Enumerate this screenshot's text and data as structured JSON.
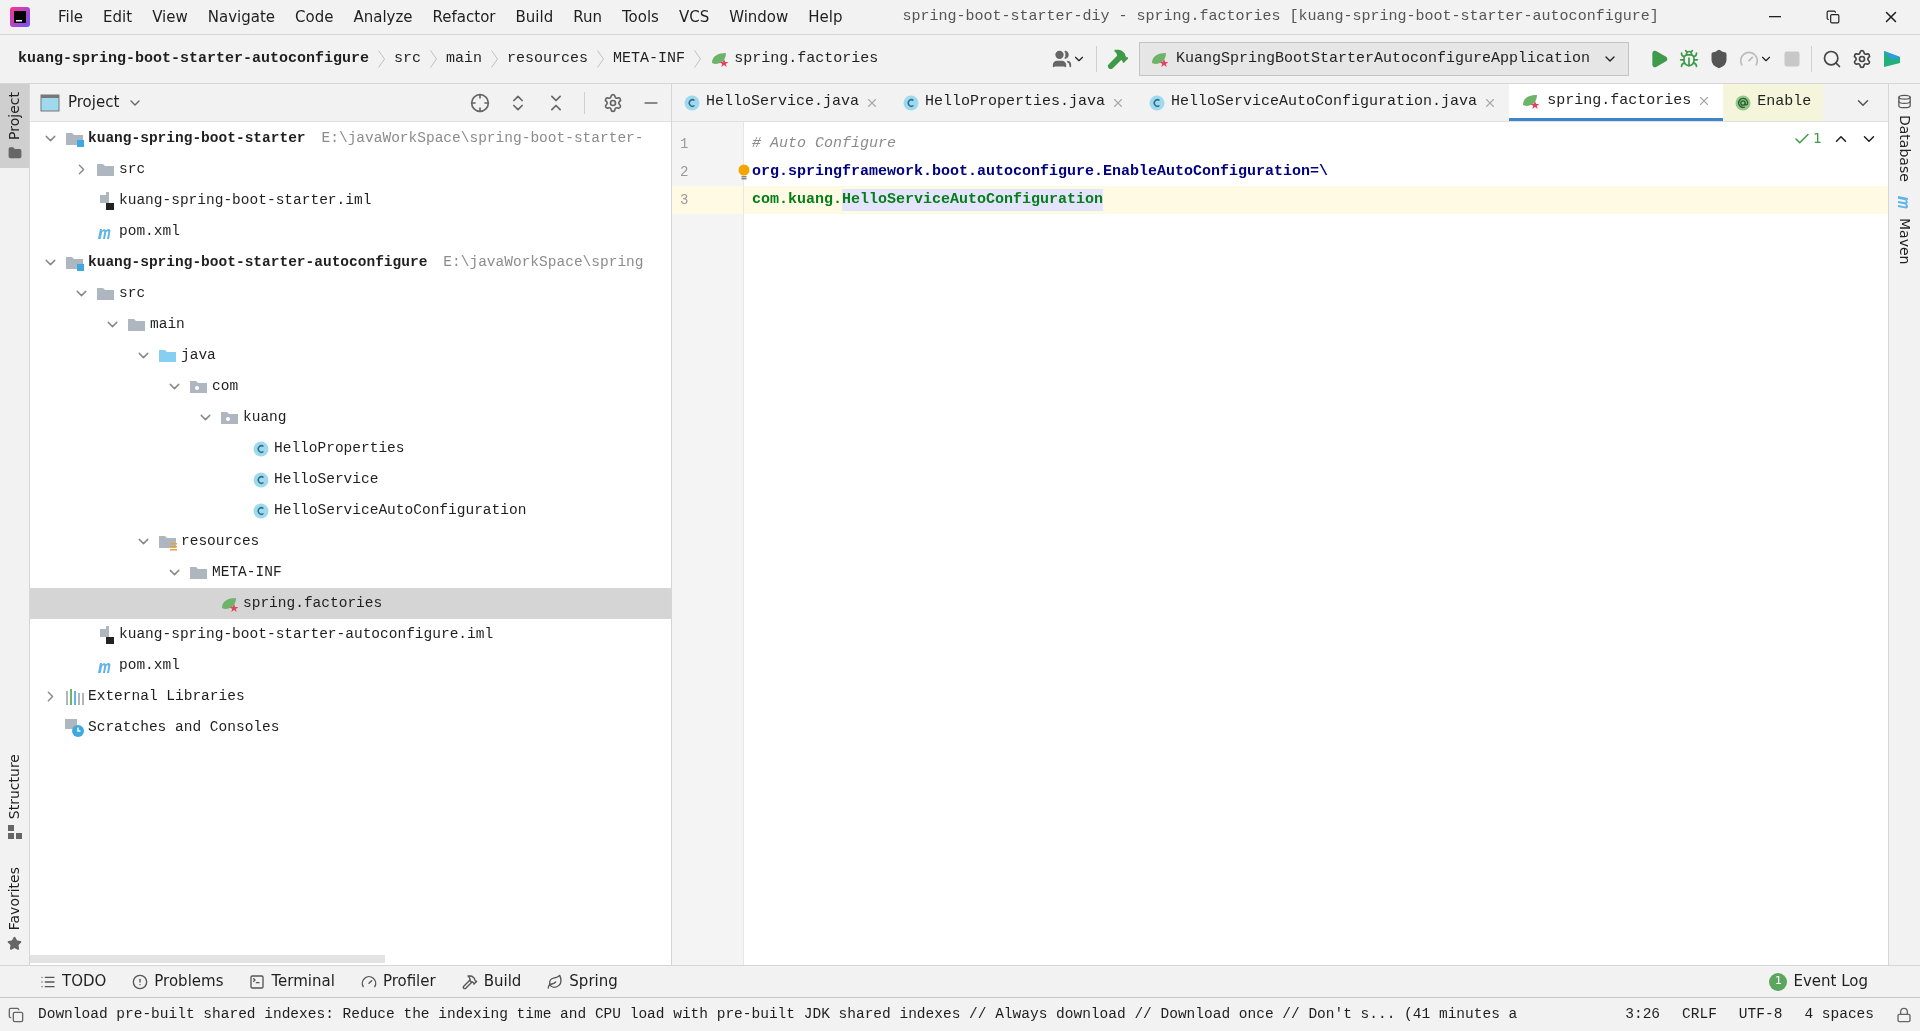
{
  "menu": [
    {
      "label": "File"
    },
    {
      "label": "Edit"
    },
    {
      "label": "View"
    },
    {
      "label": "Navigate"
    },
    {
      "label": "Code"
    },
    {
      "label": "Analyze"
    },
    {
      "label": "Refactor"
    },
    {
      "label": "Build"
    },
    {
      "label": "Run"
    },
    {
      "label": "Tools"
    },
    {
      "label": "VCS"
    },
    {
      "label": "Window"
    },
    {
      "label": "Help"
    }
  ],
  "window": {
    "title": "spring-boot-starter-diy - spring.factories [kuang-spring-boot-starter-autoconfigure]"
  },
  "breadcrumbs": [
    {
      "label": "kuang-spring-boot-starter-autoconfigure",
      "kind": "module"
    },
    {
      "label": "src",
      "kind": "plain"
    },
    {
      "label": "main",
      "kind": "plain"
    },
    {
      "label": "resources",
      "kind": "plain"
    },
    {
      "label": "META-INF",
      "kind": "plain"
    },
    {
      "label": "spring.factories",
      "kind": "spring"
    }
  ],
  "run_config": {
    "label": "KuangSpringBootStarterAutoconfigureApplication"
  },
  "left_tools": [
    {
      "label": "Project",
      "selected": true,
      "kind": "project"
    }
  ],
  "left_tools_bottom": [
    {
      "label": "Structure",
      "selected": false,
      "kind": "structure"
    },
    {
      "label": "Favorites",
      "selected": false,
      "kind": "favorites"
    }
  ],
  "right_tools": [
    {
      "label": "Database",
      "kind": "database"
    },
    {
      "label": "Maven",
      "kind": "maven"
    }
  ],
  "project_panel": {
    "title": "Project"
  },
  "tree": [
    {
      "label": "kuang-spring-boot-starter",
      "kind": "module",
      "path": "E:\\javaWorkSpace\\spring-boot-starter-",
      "expanded": true,
      "selected": false,
      "children": [
        {
          "label": "src",
          "kind": "folder",
          "expanded": false,
          "selected": false
        },
        {
          "label": "kuang-spring-boot-starter.iml",
          "kind": "iml",
          "selected": false
        },
        {
          "label": "pom.xml",
          "kind": "maven",
          "selected": false
        }
      ]
    },
    {
      "label": "kuang-spring-boot-starter-autoconfigure",
      "kind": "module",
      "path": "E:\\javaWorkSpace\\spring",
      "expanded": true,
      "selected": false,
      "children": [
        {
          "label": "src",
          "kind": "folder",
          "expanded": true,
          "selected": false,
          "children": [
            {
              "label": "main",
              "kind": "folder",
              "expanded": true,
              "selected": false,
              "children": [
                {
                  "label": "java",
                  "kind": "source",
                  "expanded": true,
                  "selected": false,
                  "children": [
                    {
                      "label": "com",
                      "kind": "package",
                      "expanded": true,
                      "selected": false,
                      "children": [
                        {
                          "label": "kuang",
                          "kind": "package",
                          "expanded": true,
                          "selected": false,
                          "children": [
                            {
                              "label": "HelloProperties",
                              "kind": "class",
                              "selected": false
                            },
                            {
                              "label": "HelloService",
                              "kind": "class",
                              "selected": false
                            },
                            {
                              "label": "HelloServiceAutoConfiguration",
                              "kind": "class",
                              "selected": false
                            }
                          ]
                        }
                      ]
                    }
                  ]
                },
                {
                  "label": "resources",
                  "kind": "resources",
                  "expanded": true,
                  "selected": false,
                  "children": [
                    {
                      "label": "META-INF",
                      "kind": "folder",
                      "expanded": true,
                      "selected": false,
                      "children": [
                        {
                          "label": "spring.factories",
                          "kind": "spring",
                          "selected": true
                        }
                      ]
                    }
                  ]
                }
              ]
            }
          ]
        },
        {
          "label": "kuang-spring-boot-starter-autoconfigure.iml",
          "kind": "iml",
          "selected": false
        },
        {
          "label": "pom.xml",
          "kind": "maven",
          "selected": false
        }
      ]
    },
    {
      "label": "External Libraries",
      "kind": "libraries",
      "expanded": false,
      "selected": false
    },
    {
      "label": "Scratches and Consoles",
      "kind": "scratches",
      "selected": false
    }
  ],
  "tabs": [
    {
      "label": "HelloService.java",
      "kind": "class",
      "selected": false
    },
    {
      "label": "HelloProperties.java",
      "kind": "class",
      "selected": false
    },
    {
      "label": "HelloServiceAutoConfiguration.java",
      "kind": "class",
      "selected": false
    },
    {
      "label": "spring.factories",
      "kind": "spring",
      "selected": true
    },
    {
      "label": "Enable",
      "kind": "annotation",
      "selected": false
    }
  ],
  "editor": {
    "inspection_count": "1",
    "lines": [
      {
        "number": "1",
        "current": false,
        "segments": [
          {
            "text": "# Auto Configure",
            "kind": "comment"
          }
        ]
      },
      {
        "number": "2",
        "current": false,
        "intention": true,
        "segments": [
          {
            "text": "org.springframework.boot.autoconfigure.EnableAutoConfiguration=\\",
            "kind": "key"
          }
        ]
      },
      {
        "number": "3",
        "current": true,
        "segments": [
          {
            "text": "com.kuang.",
            "kind": "value"
          },
          {
            "text": "HelloServiceAutoConfiguration",
            "kind": "value-highlight"
          }
        ]
      }
    ]
  },
  "bottom_tools": [
    {
      "label": "TODO",
      "kind": "todo"
    },
    {
      "label": "Problems",
      "kind": "problems"
    },
    {
      "label": "Terminal",
      "kind": "terminal"
    },
    {
      "label": "Profiler",
      "kind": "profiler"
    },
    {
      "label": "Build",
      "kind": "build"
    },
    {
      "label": "Spring",
      "kind": "spring"
    }
  ],
  "event_log": {
    "label": "Event Log",
    "badge": "1"
  },
  "status_bar": {
    "message": "Download pre-built shared indexes: Reduce the indexing time and CPU load with pre-built JDK shared indexes // Always download // Download once // Don't s... (41 minutes a",
    "position": "3:26",
    "line_ending": "CRLF",
    "encoding": "UTF-8",
    "indent": "4 spaces"
  }
}
